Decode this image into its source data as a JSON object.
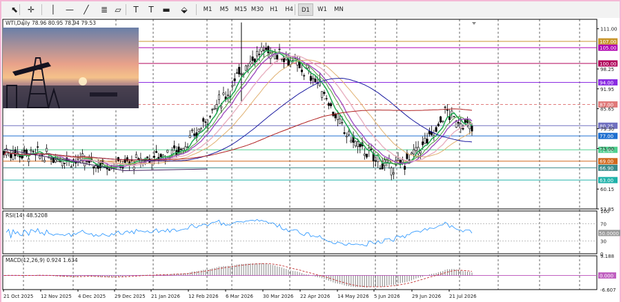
{
  "toolbar": {
    "tools": [
      {
        "name": "cursor-icon",
        "glyph": "⬉"
      },
      {
        "name": "crosshair-icon",
        "glyph": "✛"
      },
      {
        "name": "vertical-line-icon",
        "glyph": "│"
      },
      {
        "name": "horizontal-line-icon",
        "glyph": "—"
      },
      {
        "name": "trendline-icon",
        "glyph": "╱"
      },
      {
        "name": "fibonacci-icon",
        "glyph": "≣"
      },
      {
        "name": "channel-icon",
        "glyph": "▱"
      },
      {
        "name": "text-icon",
        "glyph": "T"
      },
      {
        "name": "label-icon",
        "glyph": "T"
      },
      {
        "name": "rectangle-icon",
        "glyph": "▬"
      },
      {
        "name": "shapes-icon",
        "glyph": "⬙"
      }
    ],
    "timeframes": [
      "M1",
      "M5",
      "M15",
      "M30",
      "H1",
      "H4",
      "D1",
      "W1",
      "MN"
    ],
    "active_timeframe": "D1"
  },
  "main": {
    "title": "WTI,Daily  78.96 80.95 78.94 79.53",
    "price_levels": [
      {
        "value": 107.0,
        "label": "107.00",
        "color": "#c8962c"
      },
      {
        "value": 105.0,
        "label": "105.00",
        "color": "#b000b0"
      },
      {
        "value": 100.0,
        "label": "100.00",
        "color": "#b0005a"
      },
      {
        "value": 94.0,
        "label": "94.00",
        "color": "#8a2be2"
      },
      {
        "value": 87.0,
        "label": "87.00",
        "color": "#e07a7a"
      },
      {
        "value": 80.25,
        "label": "80.25",
        "color": "#7070c0"
      },
      {
        "value": 77.0,
        "label": "77.00",
        "color": "#1f6fd0"
      },
      {
        "value": 72.6,
        "label": "72.60",
        "color": "#50d090"
      },
      {
        "value": 69.0,
        "label": "69.00",
        "color": "#d2691e"
      },
      {
        "value": 66.9,
        "label": "66.90",
        "color": "#3a8a8a"
      },
      {
        "value": 63.0,
        "label": "63.00",
        "color": "#20b2aa"
      }
    ],
    "axis_ticks": [
      "111.00",
      "98.25",
      "91.95",
      "85.65",
      "79.30",
      "73.00",
      "60.15",
      "53.85"
    ]
  },
  "rsi": {
    "title": "RSI(14) 48.5208",
    "axis_ticks": [
      "100",
      "70",
      "30",
      "0"
    ],
    "current_label": "50.0000",
    "current": 48.52
  },
  "macd": {
    "title": "MACD(12,26,9) 0.924 1.634",
    "axis_ticks": [
      "9.188",
      "-6.607"
    ],
    "zero_label": "0.000"
  },
  "x_axis": [
    "21 Oct 2025",
    "12 Nov 2025",
    "4 Dec 2025",
    "29 Dec 2025",
    "21 Jan 2026",
    "12 Feb 2026",
    "6 Mar 2026",
    "30 Mar 2026",
    "22 Apr 2026",
    "14 May 2026",
    "5 Jun 2026",
    "29 Jun 2026",
    "21 Jul 2026"
  ]
}
